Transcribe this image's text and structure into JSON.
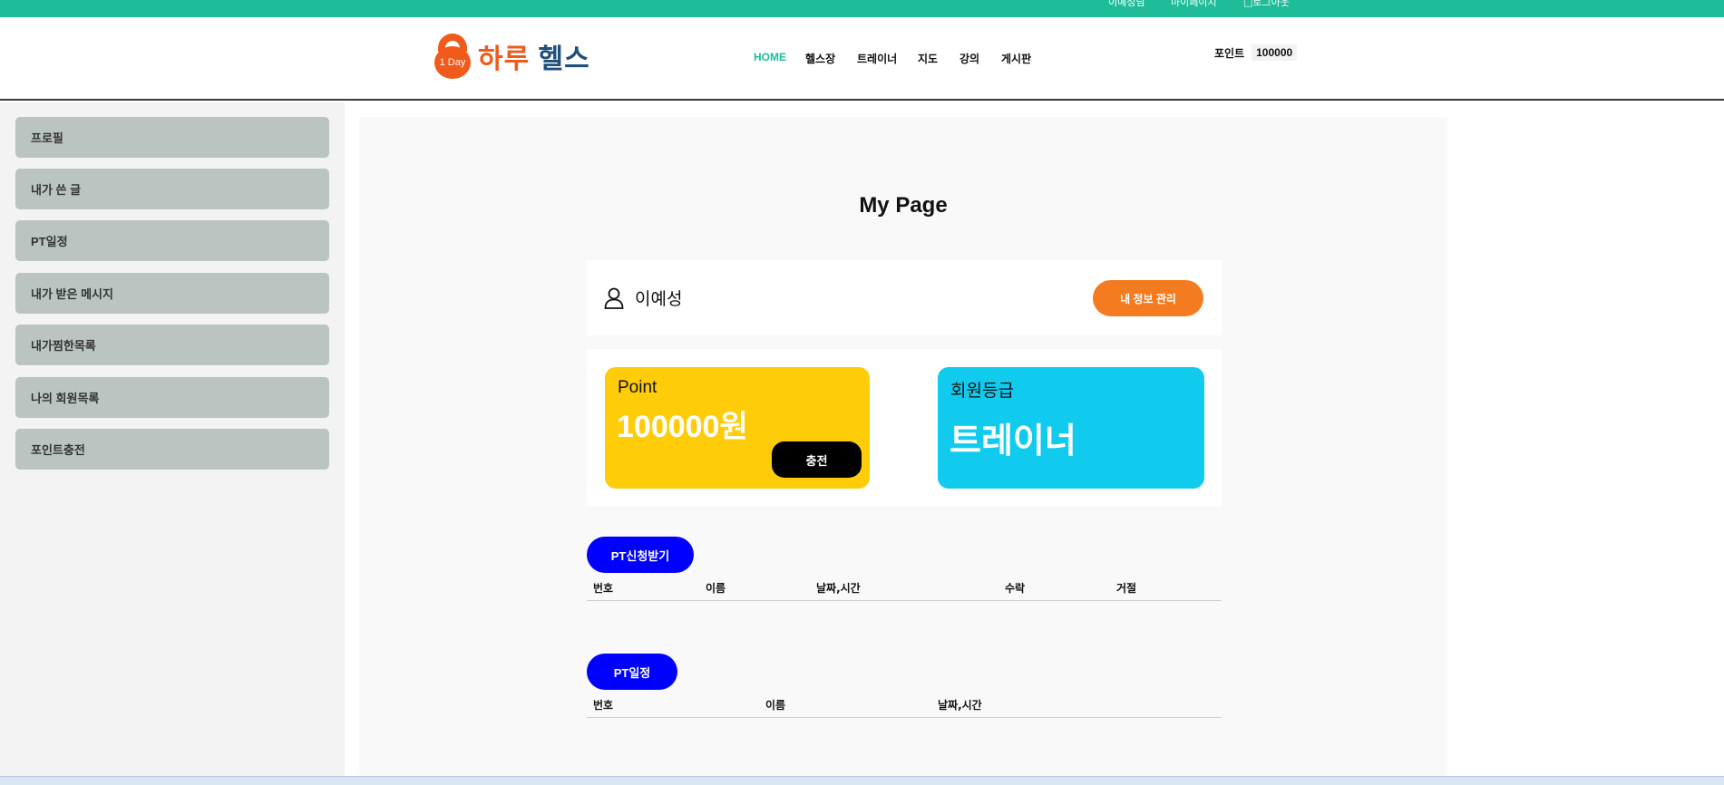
{
  "top_links": [
    "이예성님",
    "마이페이지",
    "□로그아웃"
  ],
  "logo": {
    "badge": "1 Day",
    "word1": "하루",
    "word2": "헬스"
  },
  "nav": [
    "HOME",
    "헬스장",
    "트레이너",
    "지도",
    "강의",
    "게시판"
  ],
  "points": {
    "label": "포인트",
    "value": "100000"
  },
  "sidebar": [
    "프로필",
    "내가 쓴 글",
    "PT일정",
    "내가 받은 메시지",
    "내가찜한목록",
    "나의 회원목록",
    "포인트충전"
  ],
  "main": {
    "title": "My Page",
    "user_name": "이예성",
    "manage_button": "내 정보 관리",
    "point_label": "Point",
    "point_value": "100000원",
    "charge_button": "충전",
    "grade_label": "회원등급",
    "grade_value": "트레이너"
  },
  "pt_requests": {
    "button": "PT신청받기",
    "columns": [
      "번호",
      "이름",
      "날짜,시간",
      "수락",
      "거절"
    ]
  },
  "pt_schedule": {
    "button": "PT일정",
    "columns": [
      "번호",
      "이름",
      "날짜,시간"
    ]
  },
  "colors": {
    "accent": "#1ebc99",
    "orange": "#f47b20",
    "point_card": "#fecc09",
    "grade_card": "#11cbef",
    "blue_button": "#0000ff",
    "sidebar_button": "#bac4c1"
  }
}
